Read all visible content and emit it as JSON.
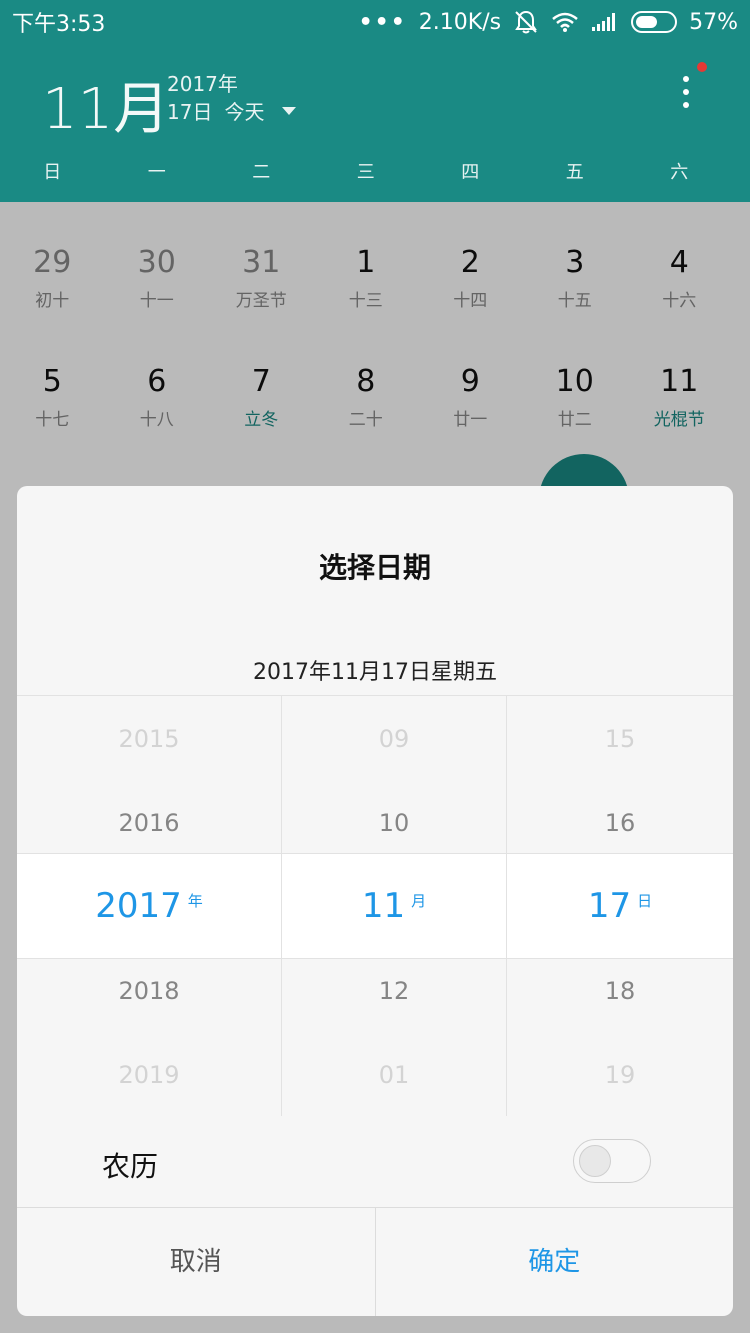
{
  "statusbar": {
    "time": "下午3:53",
    "dots": "•••",
    "net_speed": "2.10K/s",
    "mute_icon": "bell-muted-icon",
    "wifi_icon": "wifi-icon",
    "signal_icon": "signal-icon",
    "battery_percent": "57%",
    "battery_level": 0.57
  },
  "header": {
    "month": "11月",
    "year": "2017年",
    "day": "17日",
    "today": "今天",
    "weekdays": [
      "日",
      "一",
      "二",
      "三",
      "四",
      "五",
      "六"
    ]
  },
  "calendar": {
    "weeks": [
      [
        {
          "num": "29",
          "lunar": "初十"
        },
        {
          "num": "30",
          "lunar": "十一"
        },
        {
          "num": "31",
          "lunar": "万圣节"
        },
        {
          "num": "1",
          "lunar": "十三"
        },
        {
          "num": "2",
          "lunar": "十四"
        },
        {
          "num": "3",
          "lunar": "十五"
        },
        {
          "num": "4",
          "lunar": "十六"
        }
      ],
      [
        {
          "num": "5",
          "lunar": "十七"
        },
        {
          "num": "6",
          "lunar": "十八"
        },
        {
          "num": "7",
          "lunar": "立冬"
        },
        {
          "num": "8",
          "lunar": "二十"
        },
        {
          "num": "9",
          "lunar": "廿一"
        },
        {
          "num": "10",
          "lunar": "廿二"
        },
        {
          "num": "11",
          "lunar": "光棍节"
        }
      ]
    ],
    "accent_color": "#1a8a84"
  },
  "dialog": {
    "title": "选择日期",
    "summary": "2017年11月17日星期五",
    "year_col": {
      "faint_top": "2015",
      "above": "2016",
      "selected": "2017",
      "unit": "年",
      "below": "2018",
      "faint_bottom": "2019"
    },
    "month_col": {
      "faint_top": "09",
      "above": "10",
      "selected": "11",
      "unit": "月",
      "below": "12",
      "faint_bottom": "01"
    },
    "day_col": {
      "faint_top": "15",
      "above": "16",
      "selected": "17",
      "unit": "日",
      "below": "18",
      "faint_bottom": "19"
    },
    "lunar_label": "农历",
    "lunar_toggle_on": false,
    "cancel": "取消",
    "confirm": "确定",
    "selected_color": "#1e96e6"
  }
}
